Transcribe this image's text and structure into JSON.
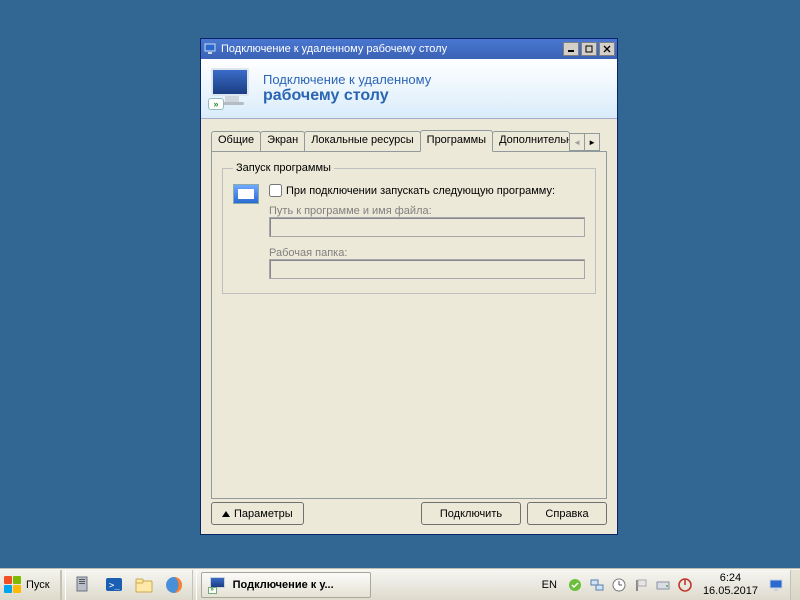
{
  "window": {
    "title": "Подключение к удаленному рабочему столу"
  },
  "banner": {
    "line1": "Подключение к удаленному",
    "line2": "рабочему столу"
  },
  "tabs": {
    "general": "Общие",
    "display": "Экран",
    "local": "Локальные ресурсы",
    "programs": "Программы",
    "advanced": "Дополнительн"
  },
  "programs_tab": {
    "group_title": "Запуск программы",
    "checkbox_label": "При подключении запускать следующую программу:",
    "path_label": "Путь к программе и имя файла:",
    "path_value": "",
    "folder_label": "Рабочая папка:",
    "folder_value": ""
  },
  "buttons": {
    "options": "Параметры",
    "connect": "Подключить",
    "help": "Справка"
  },
  "taskbar": {
    "start": "Пуск",
    "active_task": "Подключение к у...",
    "lang": "EN",
    "time": "6:24",
    "date": "16.05.2017"
  }
}
